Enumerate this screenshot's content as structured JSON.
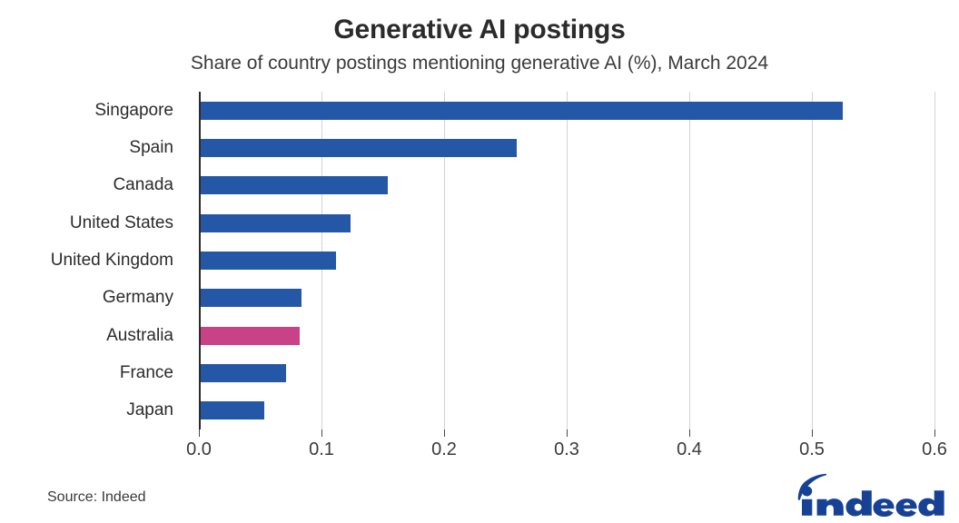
{
  "chart_data": {
    "type": "bar",
    "orientation": "horizontal",
    "title": "Generative AI postings",
    "subtitle": "Share of country postings mentioning generative AI (%), March 2024",
    "xlabel": "",
    "ylabel": "",
    "categories": [
      "Singapore",
      "Spain",
      "Canada",
      "United States",
      "United Kingdom",
      "Germany",
      "Australia",
      "France",
      "Japan"
    ],
    "values": [
      0.525,
      0.259,
      0.154,
      0.124,
      0.112,
      0.084,
      0.082,
      0.071,
      0.053
    ],
    "bar_colors": [
      "#2557A7",
      "#2557A7",
      "#2557A7",
      "#2557A7",
      "#2557A7",
      "#2557A7",
      "#C94288",
      "#2557A7",
      "#2557A7"
    ],
    "highlighted_category": "Australia",
    "xlim": [
      0.0,
      0.6
    ],
    "xticks": [
      0.0,
      0.1,
      0.2,
      0.3,
      0.4,
      0.5,
      0.6
    ],
    "xtick_labels": [
      "0.0",
      "0.1",
      "0.2",
      "0.3",
      "0.4",
      "0.5",
      "0.6"
    ],
    "grid": "vertical",
    "legend": "none"
  },
  "footer": {
    "source": "Source: Indeed",
    "logo_text": "indeed",
    "logo_color": "#164194"
  },
  "colors": {
    "bar_blue": "#2557A7",
    "bar_pink": "#C94288",
    "gridline": "#d2d2d2",
    "axis": "#2b2b2b",
    "text": "#2b2b2b"
  }
}
